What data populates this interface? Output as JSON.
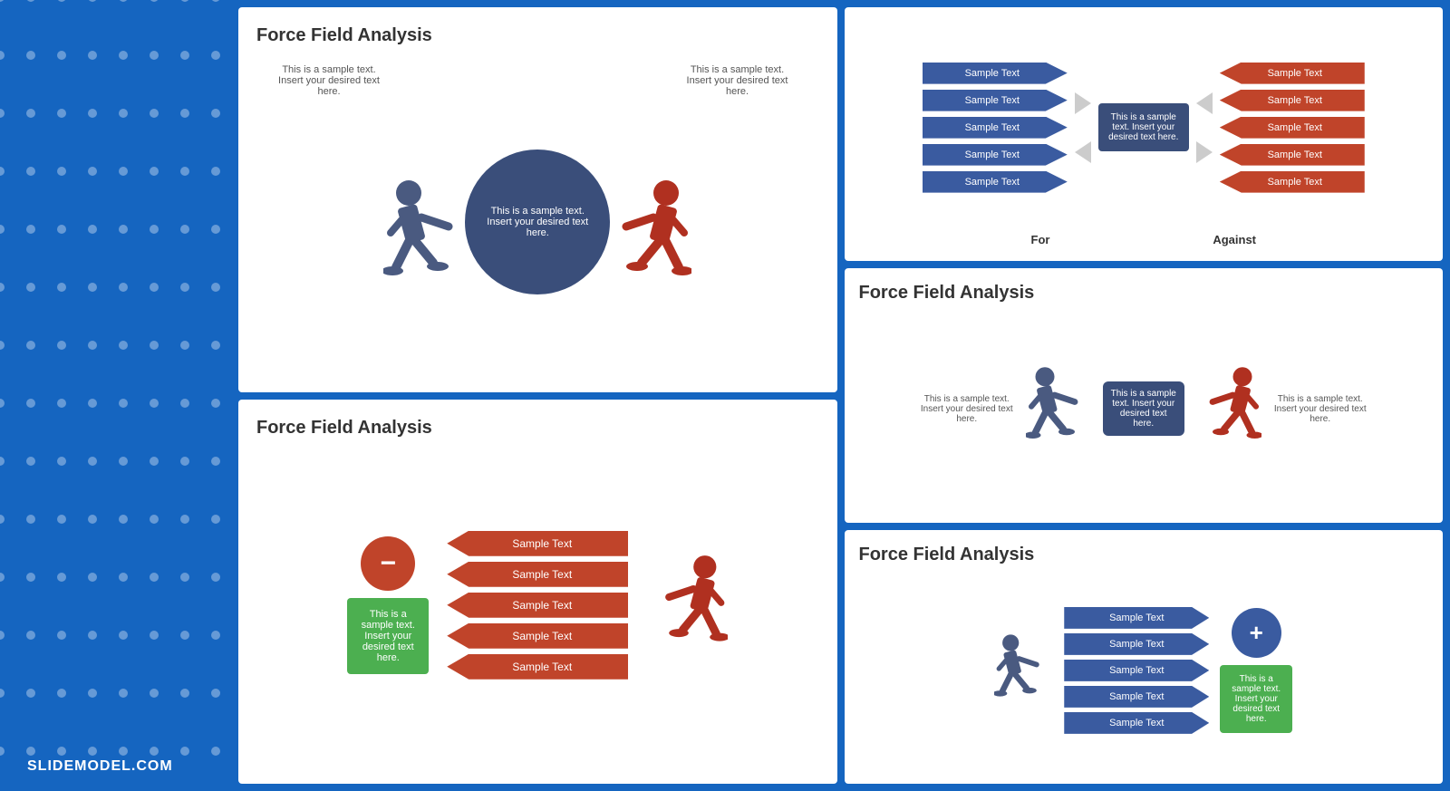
{
  "brand": "SLIDEMODEL.COM",
  "slide1": {
    "title": "Force Field Analysis",
    "text_left": "This is a sample text. Insert your desired text here.",
    "text_right": "This is a sample text. Insert your desired text here.",
    "circle_text": "This is a sample text. Insert your desired text here."
  },
  "slide2": {
    "arrows_left": [
      "Sample Text",
      "Sample Text",
      "Sample Text",
      "Sample Text",
      "Sample Text"
    ],
    "arrows_right": [
      "Sample Text",
      "Sample Text",
      "Sample Text",
      "Sample Text",
      "Sample Text"
    ],
    "center_text": "This is a sample text. Insert your desired text here.",
    "label_for": "For",
    "label_against": "Against"
  },
  "slide3": {
    "title": "Force Field Analysis",
    "minus_symbol": "−",
    "green_text": "This is a sample text. Insert your desired text here.",
    "arrows": [
      "Sample Text",
      "Sample Text",
      "Sample Text",
      "Sample Text",
      "Sample Text"
    ]
  },
  "slide4": {
    "title": "Force Field Analysis",
    "text_left": "This is a sample text. Insert your desired text here.",
    "text_right": "This is a sample text. Insert your desired text here.",
    "center_text": "This is a sample text. Insert your desired text here."
  },
  "slide5": {
    "title": "Force Field Analysis",
    "plus_symbol": "+",
    "arrows": [
      "Sample Text",
      "Sample Text",
      "Sample Text",
      "Sample Text",
      "Sample Text"
    ],
    "green_text": "This is a sample text. Insert your desired text here."
  },
  "colors": {
    "blue_dark": "#3A4E7A",
    "blue_mid": "#3A5BA0",
    "red": "#C0442A",
    "green": "#4CAF50",
    "bg": "#1565C0"
  }
}
